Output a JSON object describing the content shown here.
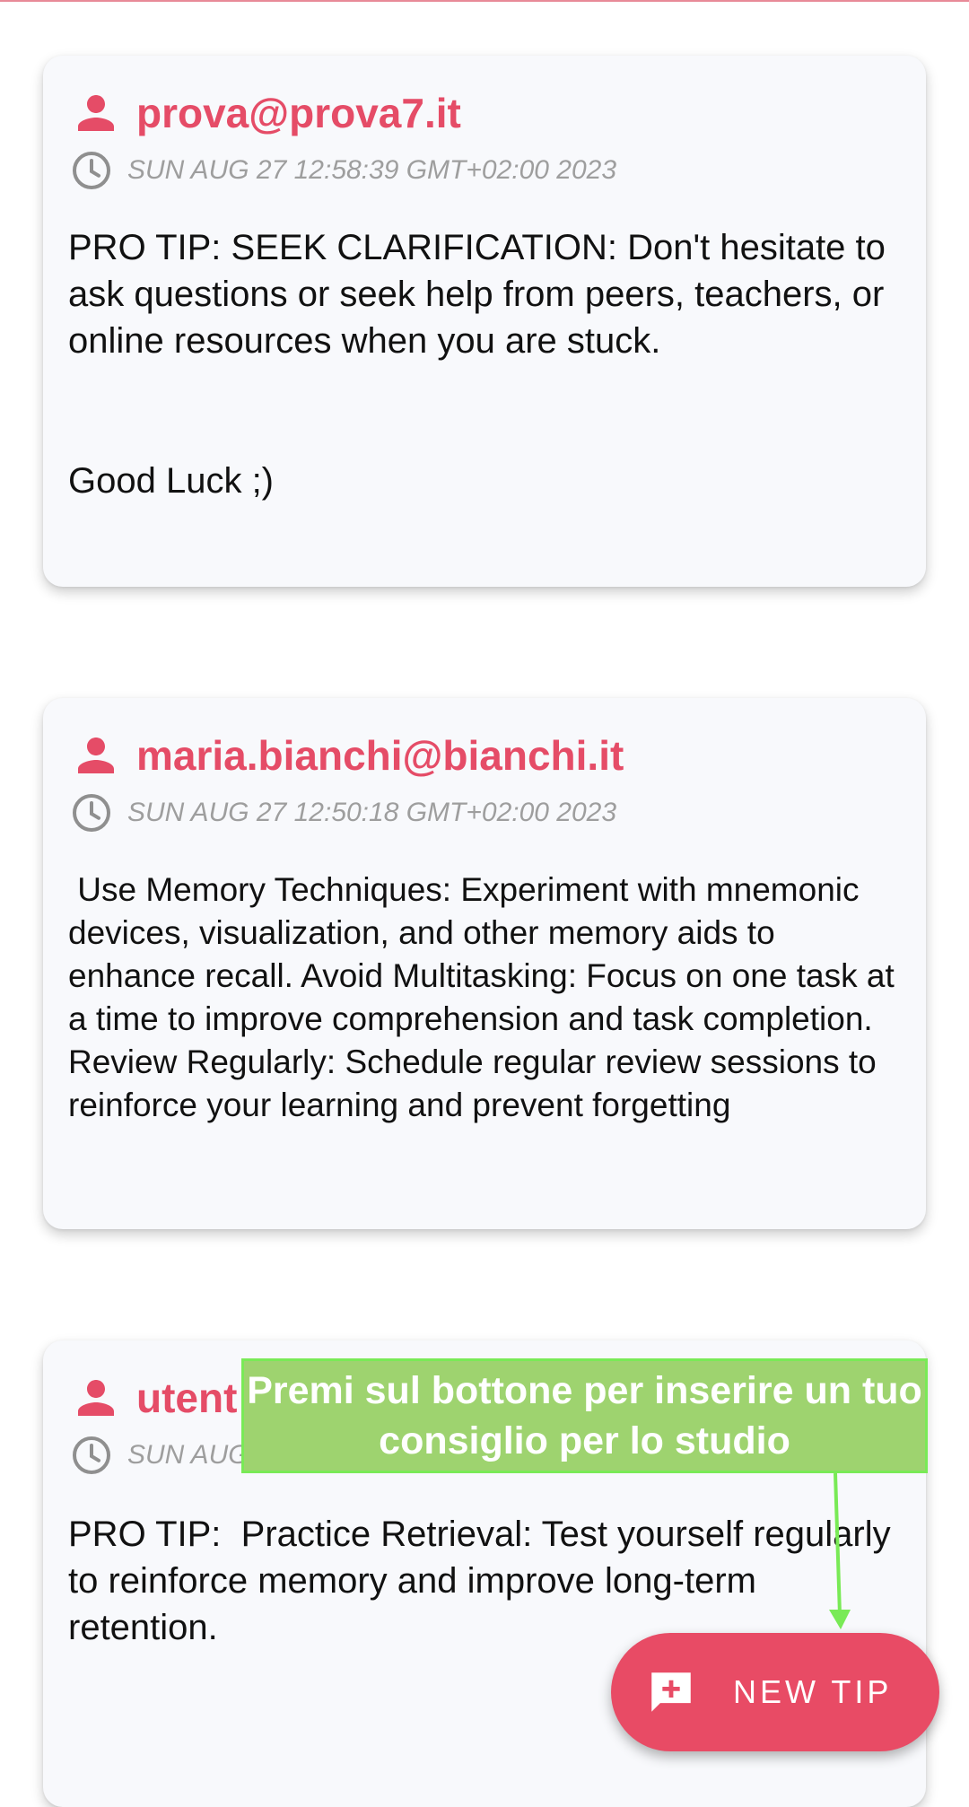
{
  "posts": [
    {
      "author": "prova@prova7.it",
      "timestamp": "SUN AUG 27 12:58:39 GMT+02:00 2023",
      "body": "PRO TIP: SEEK CLARIFICATION: Don't hesitate to ask questions or seek help from peers, teachers, or online resources when you are stuck.\n\n\nGood Luck ;)"
    },
    {
      "author": "maria.bianchi@bianchi.it",
      "timestamp": "SUN AUG 27 12:50:18 GMT+02:00 2023",
      "body": " Use Memory Techniques: Experiment with mnemonic devices, visualization, and other memory aids to enhance recall. Avoid Multitasking: Focus on one task at a time to improve comprehension and task completion. Review Regularly: Schedule regular review sessions to reinforce your learning and prevent forgetting"
    },
    {
      "author": "utent",
      "timestamp": "SUN AUG",
      "body": "PRO TIP:  Practice Retrieval: Test yourself regularly to reinforce memory and improve long-term retention."
    }
  ],
  "fab": {
    "label": "NEW TIP",
    "icon": "add-comment-icon"
  },
  "hint": {
    "text": "Premi sul bottone per inserire un tuo consiglio per lo studio"
  },
  "colors": {
    "accent": "#e84b65",
    "hint_bg": "#9ed36f",
    "hint_arrow": "#79ea56",
    "card_bg": "#f8f9fc"
  }
}
